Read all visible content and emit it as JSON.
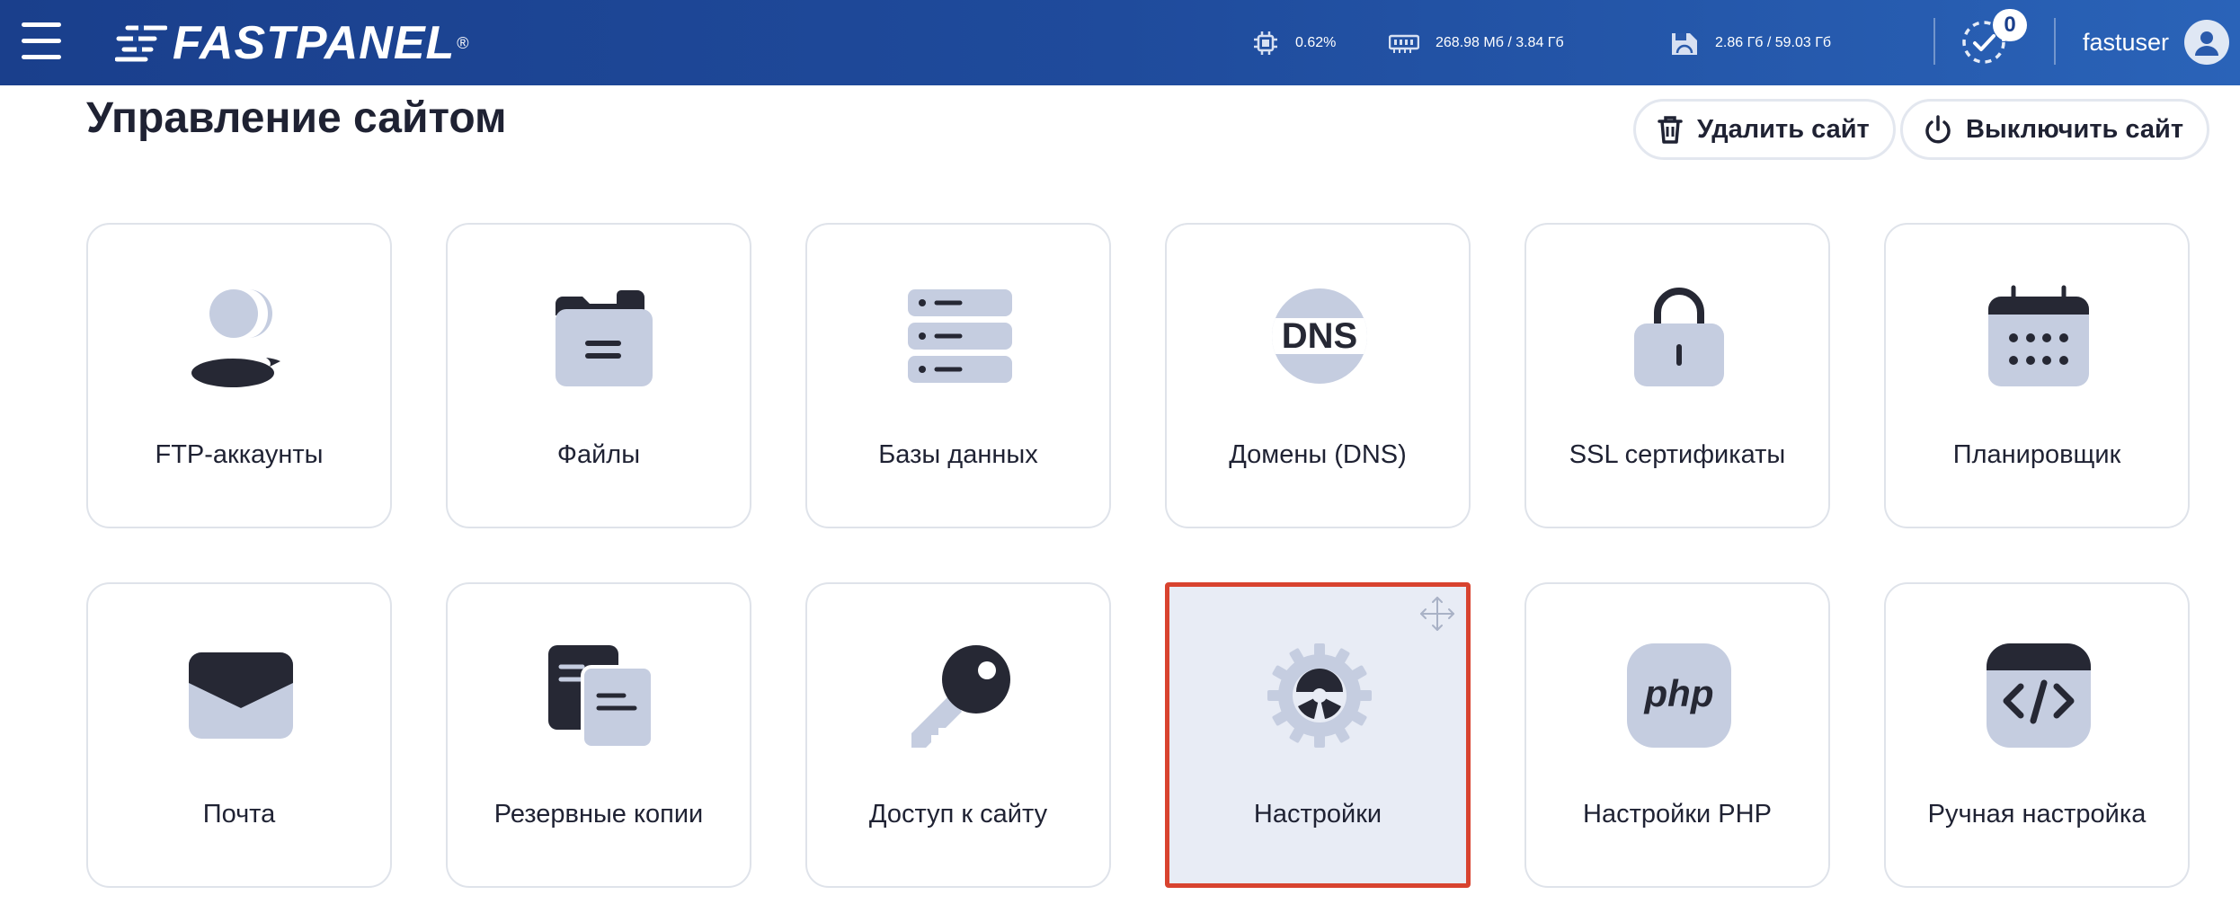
{
  "topbar": {
    "brand": "FASTPANEL",
    "brand_mark": "®",
    "cpu": "0.62%",
    "ram": "268.98 Мб / 3.84 Гб",
    "disk": "2.86 Гб / 59.03 Гб",
    "tasks_count": "0",
    "username": "fastuser"
  },
  "page": {
    "title": "Управление сайтом",
    "delete_label": "Удалить сайт",
    "disable_label": "Выключить сайт"
  },
  "tiles": [
    {
      "label": "FTP-аккаунты",
      "icon": "user-icon"
    },
    {
      "label": "Файлы",
      "icon": "folder-icon"
    },
    {
      "label": "Базы данных",
      "icon": "database-icon"
    },
    {
      "label": "Домены (DNS)",
      "icon": "dns-icon"
    },
    {
      "label": "SSL сертификаты",
      "icon": "lock-icon"
    },
    {
      "label": "Планировщик",
      "icon": "calendar-icon"
    },
    {
      "label": "Почта",
      "icon": "mail-icon"
    },
    {
      "label": "Резервные копии",
      "icon": "backup-icon"
    },
    {
      "label": "Доступ к сайту",
      "icon": "key-icon"
    },
    {
      "label": "Настройки",
      "icon": "gear-icon"
    },
    {
      "label": "Настройки PHP",
      "icon": "php-icon",
      "icon_text": "php"
    },
    {
      "label": "Ручная настройка",
      "icon": "code-icon"
    }
  ],
  "colors": {
    "accent_dark": "#262834",
    "icon_light": "#c5cde0",
    "highlight_border": "#d8432f"
  }
}
